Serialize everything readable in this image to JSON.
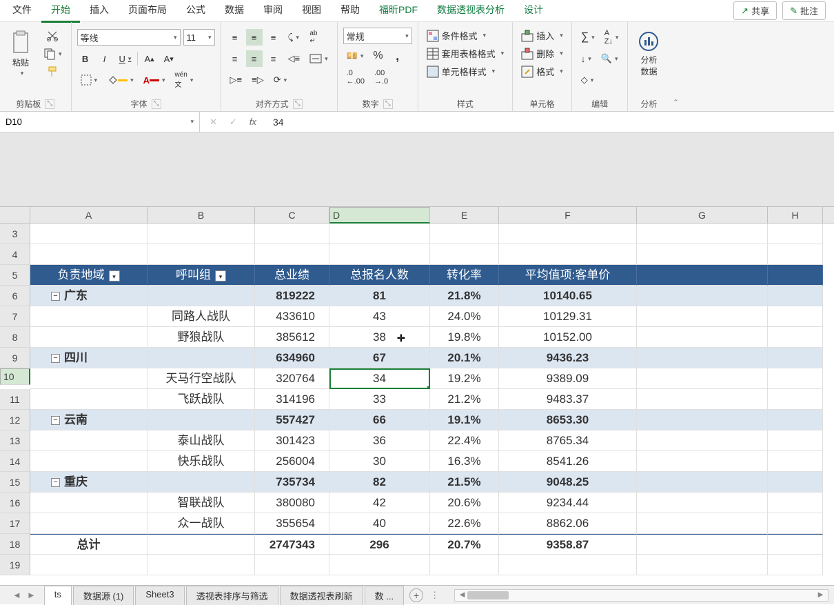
{
  "menu": {
    "items": [
      "文件",
      "开始",
      "插入",
      "页面布局",
      "公式",
      "数据",
      "审阅",
      "视图",
      "帮助",
      "福昕PDF",
      "数据透视表分析",
      "设计"
    ],
    "active": 1,
    "share": "共享",
    "comment": "批注"
  },
  "ribbon": {
    "clipboard": {
      "paste": "粘贴",
      "label": "剪贴板"
    },
    "font": {
      "name": "等线",
      "size": "11",
      "bold": "B",
      "italic": "I",
      "underline": "U",
      "label": "字体"
    },
    "align": {
      "label": "对齐方式"
    },
    "number": {
      "format": "常规",
      "label": "数字"
    },
    "styles": {
      "cond": "条件格式",
      "tablefmt": "套用表格格式",
      "cellstyle": "单元格样式",
      "label": "样式"
    },
    "cells": {
      "insert": "插入",
      "delete": "删除",
      "format": "格式",
      "label": "单元格"
    },
    "editing": {
      "label": "编辑"
    },
    "analysis": {
      "btn": "分析\n数据",
      "label": "分析"
    }
  },
  "namebox": "D10",
  "formula": "34",
  "cols": [
    "A",
    "B",
    "C",
    "D",
    "E",
    "F",
    "G",
    "H"
  ],
  "selCol": "D",
  "selRow": 10,
  "pivot": {
    "headers": [
      "负责地域",
      "呼叫组",
      "总业绩",
      "总报名人数",
      "转化率",
      "平均值项:客单价"
    ],
    "regions": [
      {
        "name": "广东",
        "c": "819222",
        "d": "81",
        "e": "21.8%",
        "f": "10140.65",
        "teams": [
          {
            "b": "同路人战队",
            "c": "433610",
            "d": "43",
            "e": "24.0%",
            "f": "10129.31"
          },
          {
            "b": "野狼战队",
            "c": "385612",
            "d": "38",
            "e": "19.8%",
            "f": "10152.00"
          }
        ]
      },
      {
        "name": "四川",
        "c": "634960",
        "d": "67",
        "e": "20.1%",
        "f": "9436.23",
        "teams": [
          {
            "b": "天马行空战队",
            "c": "320764",
            "d": "34",
            "e": "19.2%",
            "f": "9389.09"
          },
          {
            "b": "飞跃战队",
            "c": "314196",
            "d": "33",
            "e": "21.2%",
            "f": "9483.37"
          }
        ]
      },
      {
        "name": "云南",
        "c": "557427",
        "d": "66",
        "e": "19.1%",
        "f": "8653.30",
        "teams": [
          {
            "b": "泰山战队",
            "c": "301423",
            "d": "36",
            "e": "22.4%",
            "f": "8765.34"
          },
          {
            "b": "快乐战队",
            "c": "256004",
            "d": "30",
            "e": "16.3%",
            "f": "8541.26"
          }
        ]
      },
      {
        "name": "重庆",
        "c": "735734",
        "d": "82",
        "e": "21.5%",
        "f": "9048.25",
        "teams": [
          {
            "b": "智联战队",
            "c": "380080",
            "d": "42",
            "e": "20.6%",
            "f": "9234.44"
          },
          {
            "b": "众一战队",
            "c": "355654",
            "d": "40",
            "e": "22.6%",
            "f": "8862.06"
          }
        ]
      }
    ],
    "total": {
      "label": "总计",
      "c": "2747343",
      "d": "296",
      "e": "20.7%",
      "f": "9358.87"
    }
  },
  "sheets": {
    "tabs": [
      "ts",
      "数据源 (1)",
      "Sheet3",
      "透视表排序与筛选",
      "数据透视表刷新",
      "数 ..."
    ],
    "active": 0
  }
}
